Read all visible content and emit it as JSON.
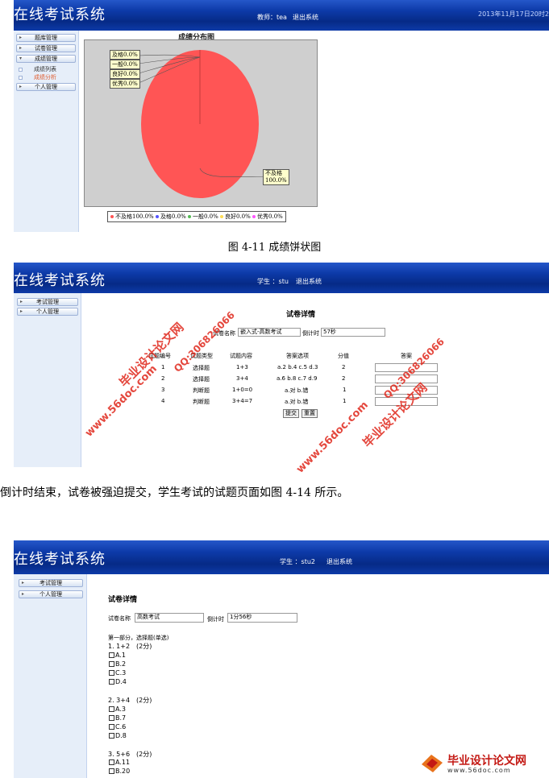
{
  "shot1": {
    "app_title": "在线考试系统",
    "user_text": "教师：tea",
    "logout": "退出系统",
    "datetime": "2013年11月17日20时2",
    "menu": [
      "题库管理",
      "试卷管理",
      "成绩管理"
    ],
    "submenu": [
      "成绩列表",
      "成绩分析"
    ],
    "menu_last": "个人管理",
    "chart_title": "成绩分布图"
  },
  "chart_data": {
    "type": "pie",
    "title": "成绩分布图",
    "categories": [
      "不及格",
      "及格",
      "一般",
      "良好",
      "优秀"
    ],
    "values": [
      100.0,
      0.0,
      0.0,
      0.0,
      0.0
    ],
    "slice_labels": [
      "不及格\n100.0%",
      "及格0.0%",
      "一般0.0%",
      "良好0.0%",
      "优秀0.0%"
    ],
    "legend": [
      "不及格100.0%",
      "及格0.0%",
      "一般0.0%",
      "良好0.0%",
      "优秀0.0%"
    ],
    "legend_position": "bottom",
    "colors": [
      "#ff5555",
      "#5555ff",
      "#55bb55",
      "#ffdd55",
      "#ff55ff"
    ]
  },
  "caption1": "图 4-11 成绩饼状图",
  "shot2": {
    "app_title": "在线考试系统",
    "user_text": "学生 ：stu",
    "logout": "退出系统",
    "menu": [
      "考试管理",
      "个人管理"
    ],
    "heading": "试卷详情",
    "paper_name_label": "试卷名称",
    "paper_name": "嵌入式-高数考试",
    "countdown_label": "倒计时",
    "countdown": "57秒",
    "columns": [
      "试题编号",
      "试题类型",
      "试题内容",
      "答案选项",
      "分值",
      "答案"
    ],
    "rows": [
      [
        "1",
        "选择题",
        "1+3",
        "a.2 b.4 c.5 d.3",
        "2"
      ],
      [
        "2",
        "选择题",
        "3+4",
        "a.6 b.8 c.7 d.9",
        "2"
      ],
      [
        "3",
        "判断题",
        "1+0=0",
        "a.对 b.错",
        "1"
      ],
      [
        "4",
        "判断题",
        "3+4=7",
        "a.对 b.错",
        "1"
      ]
    ],
    "submit": "提交",
    "reset": "重置"
  },
  "watermarks": {
    "site_cn": "毕业设计论文网",
    "site_url": "www.56doc.com",
    "qq": "QQ:306826066"
  },
  "paragraph": "倒计时结束，试卷被强迫提交，学生考试的试题页面如图 4-14 所示。",
  "shot3": {
    "app_title": "在线考试系统",
    "user_text": "学生 ：stu2",
    "logout": "退出系统",
    "menu": [
      "考试管理",
      "个人管理"
    ],
    "heading": "试卷详情",
    "paper_name_label": "试卷名称",
    "paper_name": "高数考试",
    "countdown_label": "倒计时",
    "countdown": "1分56秒",
    "section": "第一部分，选择题(单选)",
    "questions": [
      {
        "title": "1. 1+2　(2分)",
        "options": [
          "A.1",
          "B.2",
          "C.3",
          "D.4"
        ]
      },
      {
        "title": "2. 3+4　(2分)",
        "options": [
          "A.3",
          "B.7",
          "C.6",
          "D.8"
        ]
      },
      {
        "title": "3. 5+6　(2分)",
        "options": [
          "A.11",
          "B.20"
        ]
      }
    ]
  },
  "footer_logo": {
    "name": "毕业设计论文网",
    "url": "www.56doc.com"
  }
}
